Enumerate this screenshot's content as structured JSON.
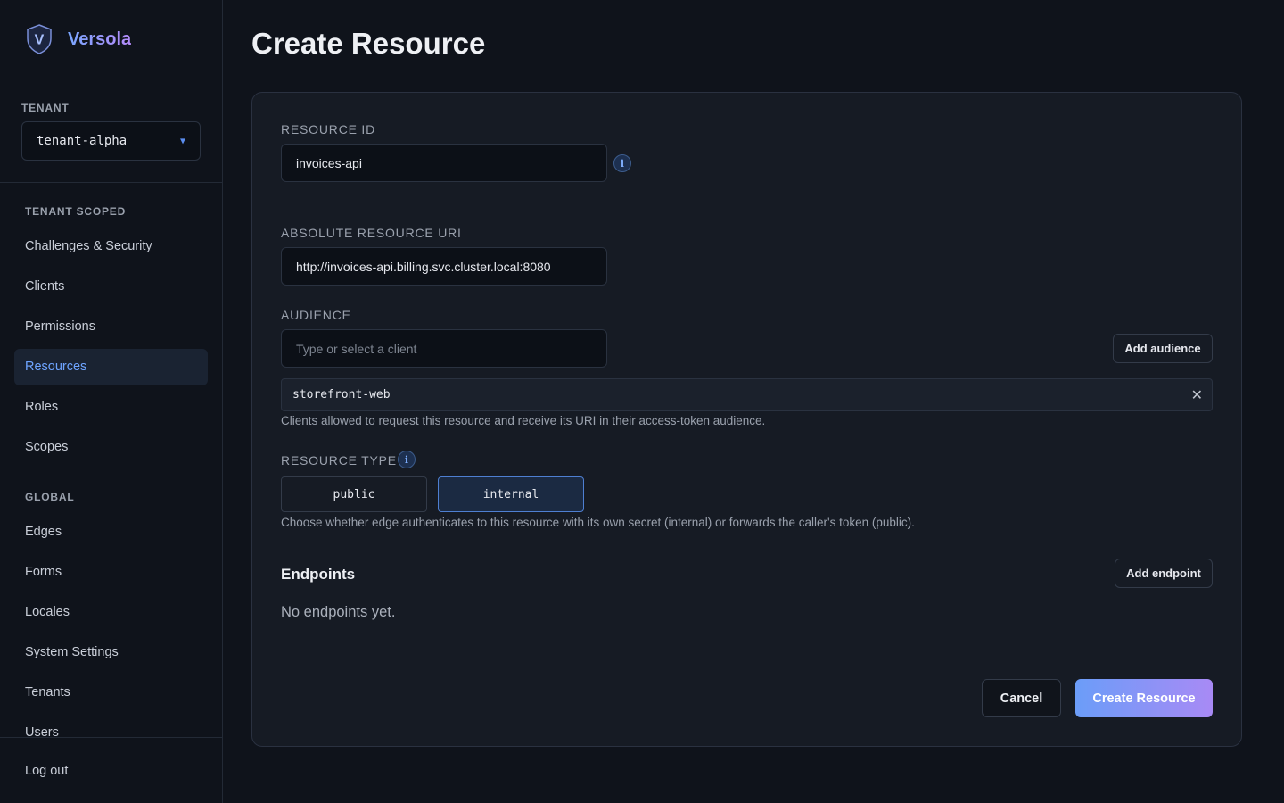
{
  "brand": {
    "name": "Versola",
    "logo_letter": "V",
    "logo_icon": "shield-v-icon"
  },
  "tenant": {
    "label": "TENANT",
    "value": "tenant-alpha"
  },
  "nav": {
    "tenant_scoped_label": "TENANT SCOPED",
    "tenant_scoped": [
      "Challenges & Security",
      "Clients",
      "Permissions",
      "Resources",
      "Roles",
      "Scopes"
    ],
    "global_label": "GLOBAL",
    "global": [
      "Edges",
      "Forms",
      "Locales",
      "System Settings",
      "Tenants",
      "Users"
    ],
    "active": "Resources",
    "logout": "Log out"
  },
  "page": {
    "title": "Create Resource"
  },
  "form": {
    "resource_id": {
      "label": "RESOURCE ID",
      "value": "invoices-api"
    },
    "resource_uri": {
      "label": "ABSOLUTE RESOURCE URI",
      "value": "http://invoices-api.billing.svc.cluster.local:8080"
    },
    "audience": {
      "label": "AUDIENCE",
      "placeholder": "Type or select a client",
      "add_label": "Add audience",
      "chips": [
        "storefront-web"
      ],
      "help": "Clients allowed to request this resource and receive its URI in their access-token audience."
    },
    "resource_type": {
      "label": "RESOURCE TYPE",
      "options": [
        "public",
        "internal"
      ],
      "selected": "internal",
      "help": "Choose whether edge authenticates to this resource with its own secret (internal) or forwards the caller's token (public)."
    },
    "endpoints": {
      "title": "Endpoints",
      "add_label": "Add endpoint",
      "empty": "No endpoints yet."
    },
    "actions": {
      "cancel": "Cancel",
      "submit": "Create Resource"
    }
  },
  "colors": {
    "accent": "#5b8def",
    "brand_gradient_start": "#7aa6ff",
    "brand_gradient_end": "#b48bfa",
    "background": "#0f131b"
  }
}
